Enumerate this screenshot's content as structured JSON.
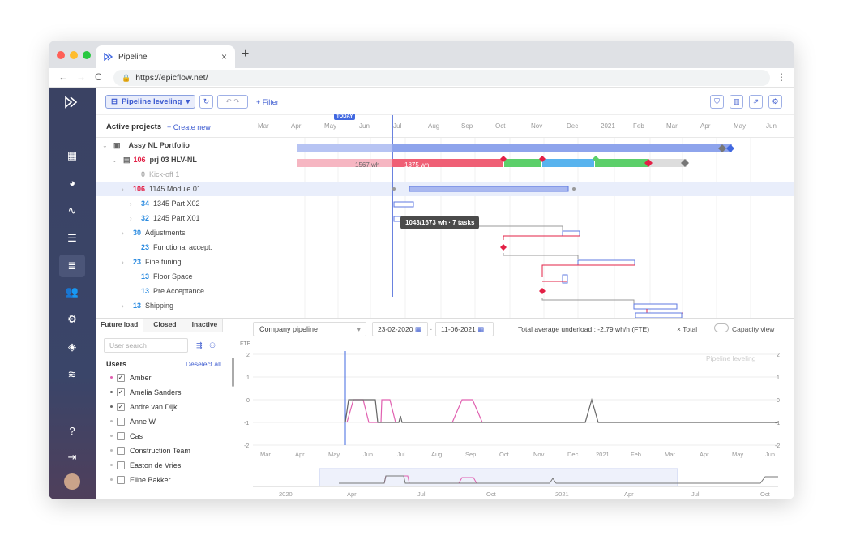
{
  "browser": {
    "tab_title": "Pipeline",
    "url_prefix": "https://",
    "url_host": "epicflow.net/"
  },
  "colors": {
    "accent": "#4168e0",
    "red": "#e32046",
    "blue": "#2b8be0"
  },
  "toolbar": {
    "pipeline_label": "Pipeline leveling",
    "filter_label": "+ Filter"
  },
  "header": {
    "active_projects": "Active projects",
    "create_new": "+ Create new",
    "today": "TODAY",
    "months": [
      "Mar",
      "Apr",
      "May",
      "Jun",
      "Jul",
      "Aug",
      "Sep",
      "Oct",
      "Nov",
      "Dec",
      "2021",
      "Feb",
      "Mar",
      "Apr",
      "May",
      "Jun"
    ]
  },
  "rows": [
    {
      "num": "",
      "label": "Assy NL Portfolio"
    },
    {
      "num": "106",
      "label": "prj 03 HLV-NL"
    },
    {
      "num": "0",
      "label": "Kick-off 1"
    },
    {
      "num": "106",
      "label": "1145 Module 01"
    },
    {
      "num": "34",
      "label": "1345 Part X02"
    },
    {
      "num": "32",
      "label": "1245 Part X01"
    },
    {
      "num": "30",
      "label": "Adjustments"
    },
    {
      "num": "23",
      "label": "Functional accept."
    },
    {
      "num": "23",
      "label": "Fine tuning"
    },
    {
      "num": "13",
      "label": "Floor Space"
    },
    {
      "num": "13",
      "label": "Pre Acceptance"
    },
    {
      "num": "13",
      "label": "Shipping"
    }
  ],
  "bar_labels": {
    "wh1": "1567 wh",
    "wh2": "1875 wh"
  },
  "tooltip": "1043/1673 wh · 7 tasks",
  "lower": {
    "tabs": [
      "Future load",
      "Closed",
      "Inactive"
    ],
    "user_search_placeholder": "User search",
    "users_heading": "Users",
    "deselect_all": "Deselect all",
    "users": [
      {
        "name": "Amber",
        "checked": "✓"
      },
      {
        "name": "Amelia Sanders",
        "checked": "✓"
      },
      {
        "name": "Andre van Dijk",
        "checked": "✓"
      },
      {
        "name": "Anne W",
        "checked": ""
      },
      {
        "name": "Cas",
        "checked": ""
      },
      {
        "name": "Construction Team",
        "checked": ""
      },
      {
        "name": "Easton de Vries",
        "checked": ""
      },
      {
        "name": "Eline Bakker",
        "checked": ""
      }
    ],
    "pipeline_select": "Company pipeline",
    "date_from": "23-02-2020",
    "date_to": "11-06-2021",
    "total_average": "Total average underload : -2.79 wh/h (FTE)",
    "total": "× Total",
    "capacity_view": "Capacity view",
    "watermark": "Pipeline leveling",
    "fte": "FTE",
    "y_ticks": [
      "2",
      "1",
      "0",
      "-1",
      "-2"
    ],
    "x_months": [
      "Mar",
      "Apr",
      "May",
      "Jun",
      "Jul",
      "Aug",
      "Sep",
      "Oct",
      "Nov",
      "Dec",
      "2021",
      "Feb",
      "Mar",
      "Apr",
      "May",
      "Jun"
    ],
    "overview_labels": [
      "2020",
      "Apr",
      "Jul",
      "Oct",
      "2021",
      "Apr",
      "Jul",
      "Oct"
    ]
  }
}
